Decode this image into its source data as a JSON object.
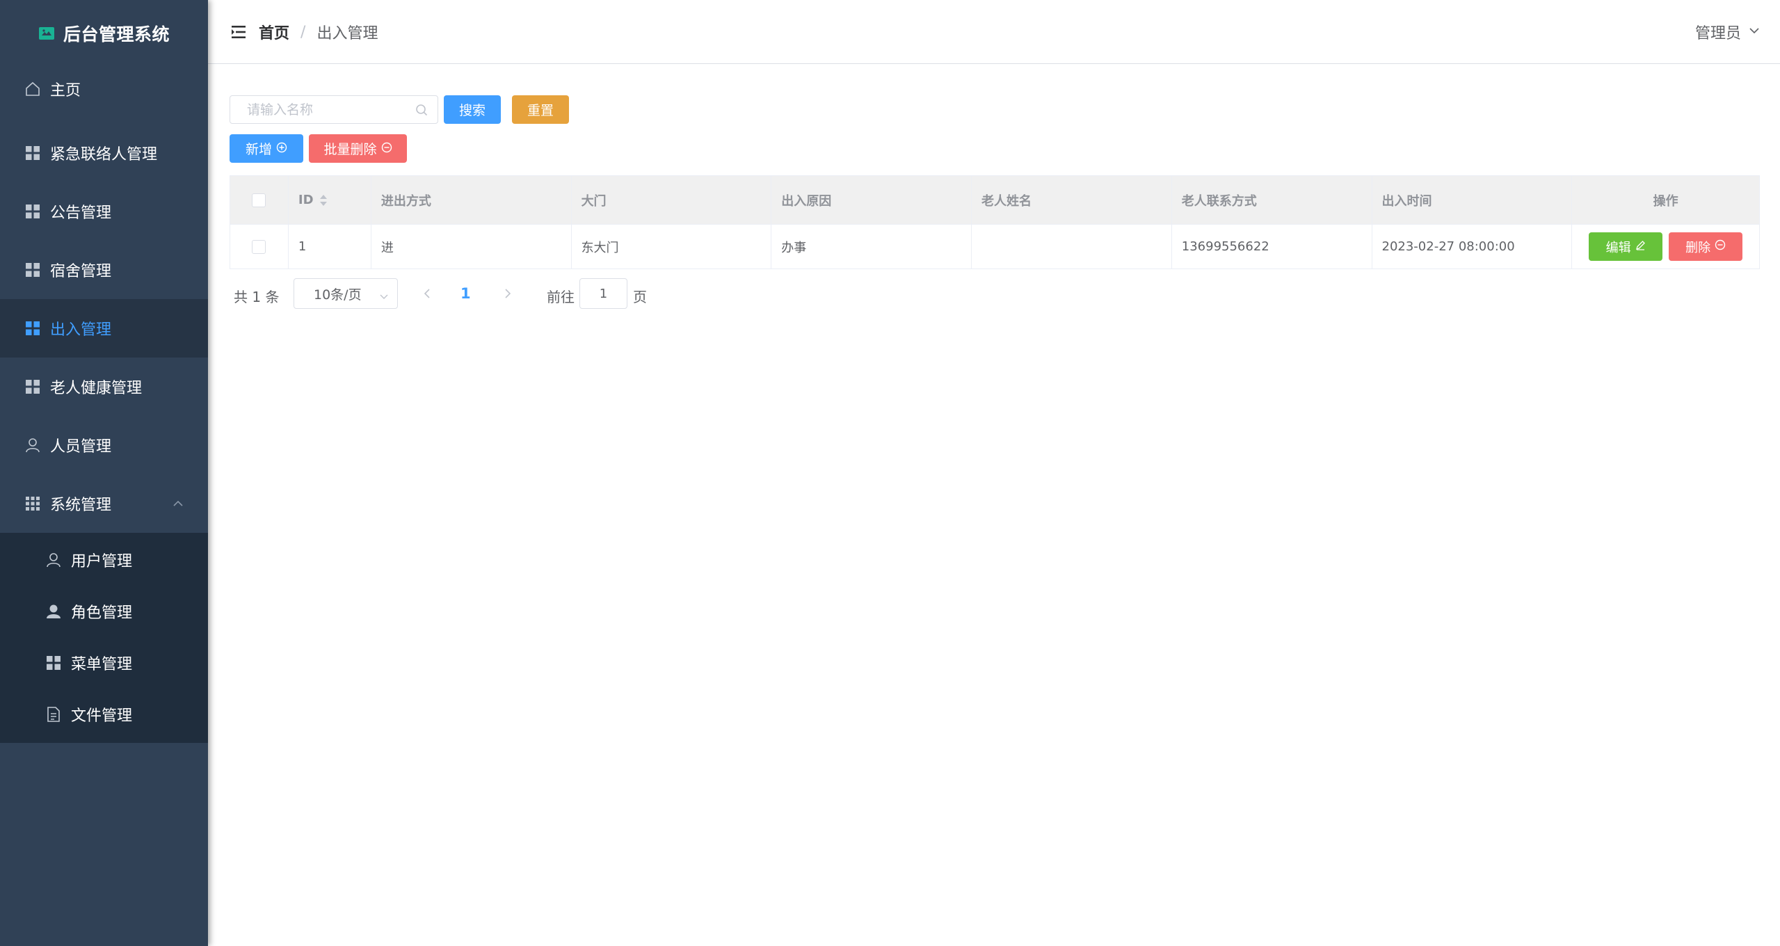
{
  "app": {
    "title": "后台管理系统",
    "accent_color": "#409eff",
    "sidebar_color": "#304156"
  },
  "sidebar": {
    "items": [
      {
        "label": "主页",
        "icon": "home-icon"
      },
      {
        "label": "紧急联络人管理",
        "icon": "grid-icon"
      },
      {
        "label": "公告管理",
        "icon": "grid-icon"
      },
      {
        "label": "宿舍管理",
        "icon": "grid-icon"
      },
      {
        "label": "出入管理",
        "icon": "grid-icon",
        "active": true
      },
      {
        "label": "老人健康管理",
        "icon": "grid-icon"
      },
      {
        "label": "人员管理",
        "icon": "user-icon"
      },
      {
        "label": "系统管理",
        "icon": "apps-icon",
        "expanded": true
      }
    ],
    "submenu": [
      {
        "label": "用户管理",
        "icon": "user-icon"
      },
      {
        "label": "角色管理",
        "icon": "avatar-icon"
      },
      {
        "label": "菜单管理",
        "icon": "grid-icon"
      },
      {
        "label": "文件管理",
        "icon": "document-icon"
      }
    ]
  },
  "header": {
    "breadcrumb_home": "首页",
    "breadcrumb_separator": "/",
    "breadcrumb_current": "出入管理",
    "user_name": "管理员"
  },
  "toolbar": {
    "search_placeholder": "请输入名称",
    "search_value": "",
    "search_label": "搜索",
    "reset_label": "重置",
    "add_label": "新增",
    "batch_delete_label": "批量删除"
  },
  "table": {
    "headers": [
      "ID",
      "进出方式",
      "大门",
      "出入原因",
      "老人姓名",
      "老人联系方式",
      "出入时间",
      "操作"
    ],
    "rows": [
      {
        "id": "1",
        "mode": "进",
        "gate": "东大门",
        "reason": "办事",
        "name": "",
        "phone": "13699556622",
        "time": "2023-02-27 08:00:00"
      }
    ],
    "edit_label": "编辑",
    "delete_label": "删除"
  },
  "pagination": {
    "total_text": "共 1 条",
    "page_size": "10条/页",
    "current_page": "1",
    "goto_label": "前往",
    "goto_value": "1",
    "goto_suffix": "页"
  }
}
